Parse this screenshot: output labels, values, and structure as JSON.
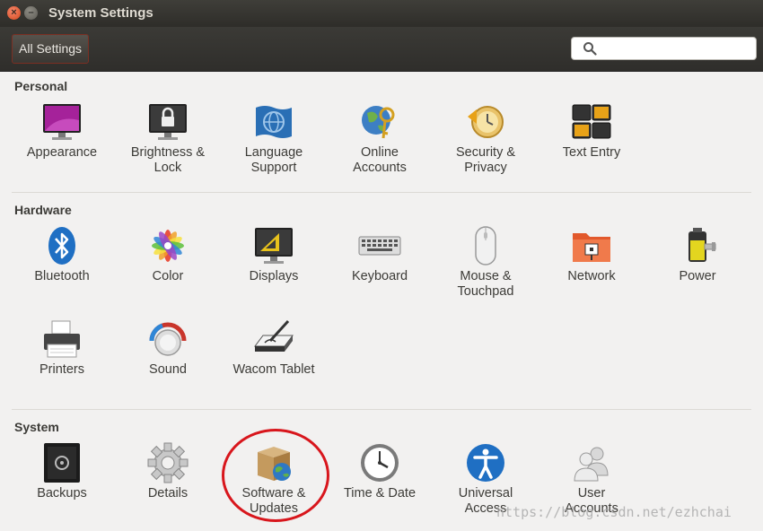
{
  "window": {
    "title": "System Settings"
  },
  "toolbar": {
    "all_settings_label": "All Settings",
    "search_placeholder": ""
  },
  "sections": {
    "personal": {
      "title": "Personal",
      "items": [
        {
          "label": "Appearance"
        },
        {
          "label": "Brightness &\nLock"
        },
        {
          "label": "Language\nSupport"
        },
        {
          "label": "Online\nAccounts"
        },
        {
          "label": "Security &\nPrivacy"
        },
        {
          "label": "Text Entry"
        }
      ]
    },
    "hardware": {
      "title": "Hardware",
      "items": [
        {
          "label": "Bluetooth"
        },
        {
          "label": "Color"
        },
        {
          "label": "Displays"
        },
        {
          "label": "Keyboard"
        },
        {
          "label": "Mouse &\nTouchpad"
        },
        {
          "label": "Network"
        },
        {
          "label": "Power"
        },
        {
          "label": "Printers"
        },
        {
          "label": "Sound"
        },
        {
          "label": "Wacom Tablet"
        }
      ]
    },
    "system": {
      "title": "System",
      "items": [
        {
          "label": "Backups"
        },
        {
          "label": "Details"
        },
        {
          "label": "Software &\nUpdates"
        },
        {
          "label": "Time & Date"
        },
        {
          "label": "Universal\nAccess"
        },
        {
          "label": "User\nAccounts"
        }
      ]
    }
  },
  "watermark": "https://blog.csdn.net/ezhchai",
  "colors": {
    "accent": "#d8161c",
    "window_dark": "#3c3b37",
    "close_button": "#e1572f"
  }
}
